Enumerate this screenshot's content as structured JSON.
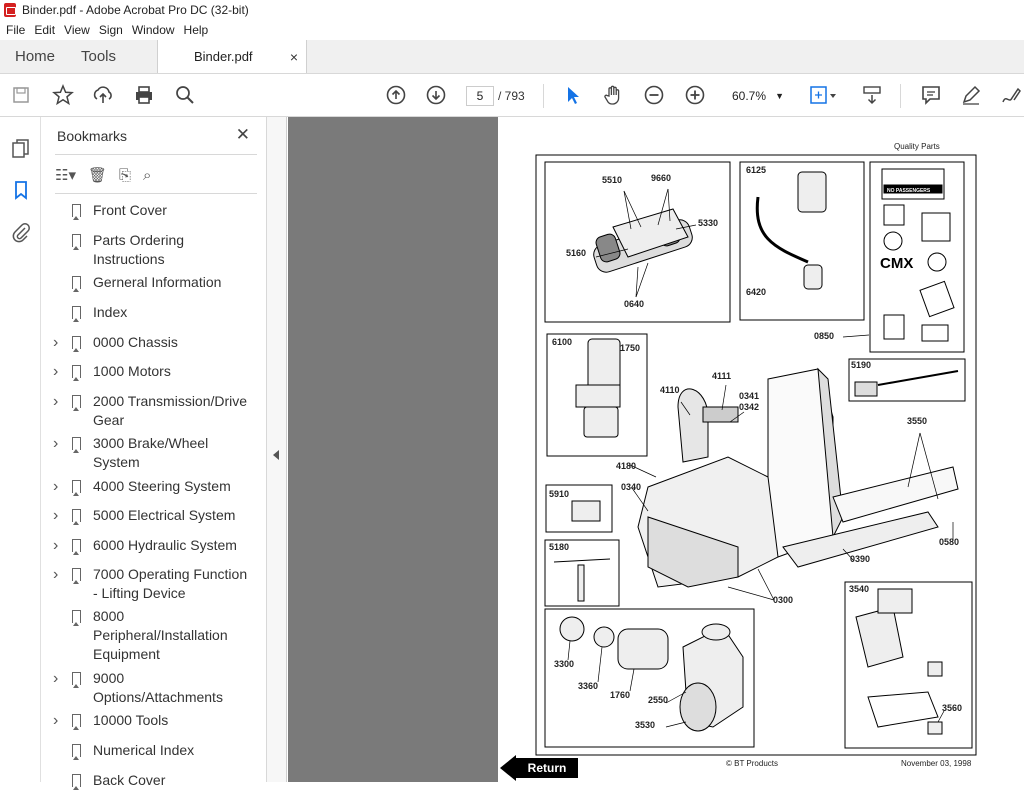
{
  "window": {
    "title": "Binder.pdf - Adobe Acrobat Pro DC (32-bit)"
  },
  "menu": [
    "File",
    "Edit",
    "View",
    "Sign",
    "Window",
    "Help"
  ],
  "tabs": {
    "home": "Home",
    "tools": "Tools",
    "document": "Binder.pdf",
    "close": "×"
  },
  "toolbar": {
    "current_page": "5",
    "page_total": "/ 793",
    "zoom": "60.7%",
    "icons": [
      "save-icon",
      "star-icon",
      "upload-icon",
      "print-icon",
      "search-icon",
      "prev-page-icon",
      "next-page-icon",
      "select-arrow-icon",
      "hand-icon",
      "zoom-out-icon",
      "zoom-in-icon",
      "fit-page-icon",
      "scroll-mode-icon",
      "comment-icon",
      "pen-icon",
      "sign-icon"
    ]
  },
  "bookmarks_panel": {
    "title": "Bookmarks",
    "close": "✕",
    "items": [
      {
        "label": "Front Cover",
        "expandable": false
      },
      {
        "label": "Parts Ordering Instructions",
        "expandable": false
      },
      {
        "label": "Gerneral Information",
        "expandable": false
      },
      {
        "label": "Index",
        "expandable": false
      },
      {
        "label": "0000 Chassis",
        "expandable": true
      },
      {
        "label": "1000 Motors",
        "expandable": true
      },
      {
        "label": "2000 Transmission/Drive Gear",
        "expandable": true
      },
      {
        "label": "3000 Brake/Wheel System",
        "expandable": true
      },
      {
        "label": "4000 Steering System",
        "expandable": true
      },
      {
        "label": "5000 Electrical System",
        "expandable": true
      },
      {
        "label": "6000 Hydraulic System",
        "expandable": true
      },
      {
        "label": "7000 Operating Function - Lifting Device",
        "expandable": true
      },
      {
        "label": "8000 Peripheral/Installation Equipment",
        "expandable": false
      },
      {
        "label": "9000 Options/Attachments",
        "expandable": true
      },
      {
        "label": "10000 Tools",
        "expandable": true
      },
      {
        "label": "Numerical Index",
        "expandable": false
      },
      {
        "label": "Back Cover",
        "expandable": false
      }
    ]
  },
  "pdf_page": {
    "header": "Quality Parts",
    "footer_left": "© BT Products",
    "footer_right": "November 03, 1998",
    "return_label": "Return",
    "part_numbers": [
      "5510",
      "9660",
      "5330",
      "5160",
      "0640",
      "6125",
      "6420",
      "0850",
      "6100",
      "1750",
      "4110",
      "4111",
      "0341",
      "0342",
      "5190",
      "3550",
      "4180",
      "0340",
      "5910",
      "0390",
      "0580",
      "5180",
      "0300",
      "3540",
      "3300",
      "3360",
      "1760",
      "2550",
      "3530",
      "3560"
    ],
    "decal_text": [
      "NO PASSENGERS",
      "CMX"
    ]
  }
}
